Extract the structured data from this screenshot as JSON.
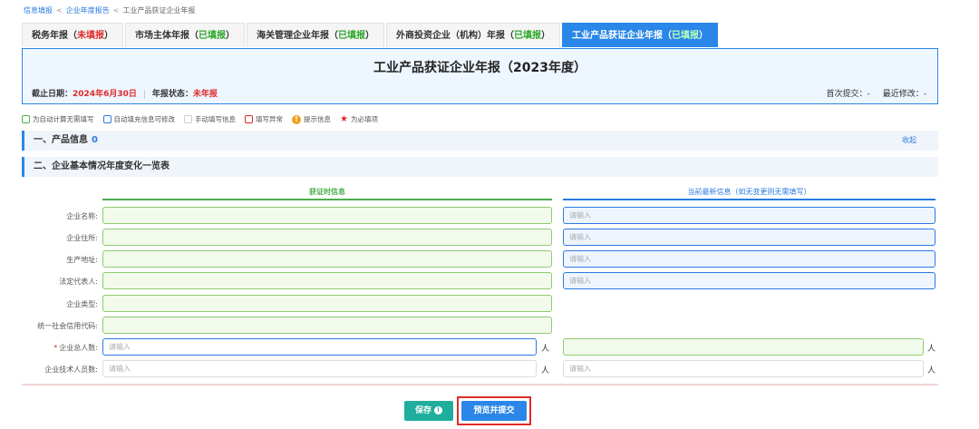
{
  "breadcrumb": {
    "items": [
      "信息填报",
      "企业年度报告",
      "工业产品获证企业年报"
    ],
    "separator": "<"
  },
  "tabs": [
    {
      "label": "税务年报",
      "status": "未填报",
      "status_type": "unfilled"
    },
    {
      "label": "市场主体年报",
      "status": "已填报",
      "status_type": "filled"
    },
    {
      "label": "海关管理企业年报",
      "status": "已填报",
      "status_type": "filled"
    },
    {
      "label": "外商投资企业（机构）年报",
      "status": "已填报",
      "status_type": "filled"
    },
    {
      "label": "工业产品获证企业年报",
      "status": "已填报",
      "status_type": "filled",
      "active": true
    }
  ],
  "header": {
    "title": "工业产品获证企业年报（2023年度）",
    "deadline_label": "截止日期：",
    "deadline_value": "2024年6月30日",
    "status_label": "年报状态：",
    "status_value": "未年报",
    "first_submit": "首次提交：-",
    "last_modified": "最近修改：-"
  },
  "legend": {
    "auto_calc": "为自动计算无需填写",
    "auto_fill": "自动填充信息可修改",
    "manual": "手动填写信息",
    "error": "填写异常",
    "hint": "提示信息",
    "required": "为必填项",
    "hint_icon": "!",
    "required_icon": "★"
  },
  "sections": {
    "product": {
      "title": "一、产品信息",
      "count": "0",
      "collapse": "收起"
    },
    "basic": {
      "title": "二、企业基本情况年度变化一览表"
    }
  },
  "form": {
    "left_header": "获证时信息",
    "right_header": "当前最新信息（如无变更则无需填写）",
    "placeholder": "请输入",
    "unit": "人",
    "required_mark": "*",
    "labels": {
      "name": "企业名称:",
      "address": "企业住所:",
      "prod_addr": "生产地址:",
      "legal_rep": "法定代表人:",
      "type": "企业类型:",
      "credit_code": "统一社会信用代码:",
      "total": "企业总人数:",
      "tech": "企业技术人员数:"
    }
  },
  "actions": {
    "save": "保存",
    "save_icon": "!",
    "submit": "预览并提交"
  },
  "colors": {
    "primary": "#2a87e8",
    "green": "#4cae4c",
    "red": "#e02a2a",
    "save": "#1fae9e"
  }
}
